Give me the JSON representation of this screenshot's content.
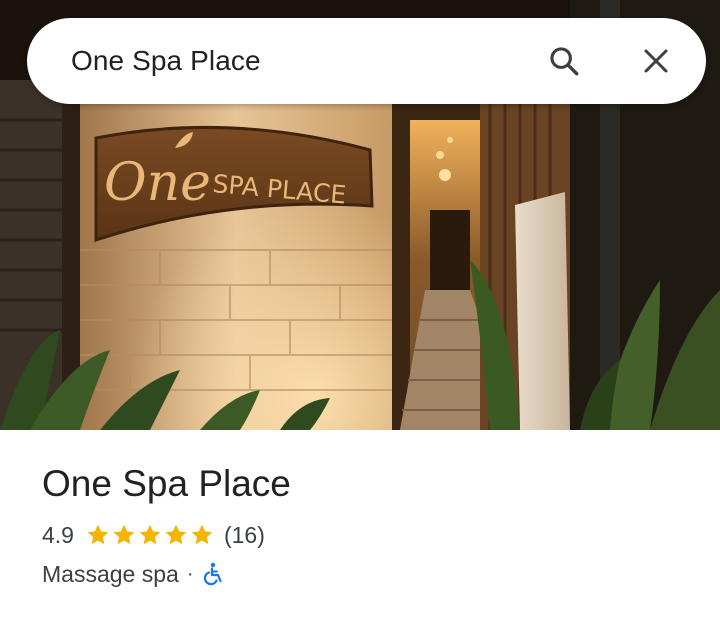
{
  "search": {
    "query": "One Spa Place",
    "search_icon": "search-icon",
    "close_icon": "close-icon"
  },
  "photo": {
    "sign_script": "One",
    "sign_text": "SPA PLACE"
  },
  "place": {
    "name": "One Spa Place",
    "rating": "4.9",
    "stars": 5,
    "review_count": "(16)",
    "category": "Massage spa",
    "separator": "·",
    "accessibility_icon": "wheelchair-accessible-icon"
  },
  "colors": {
    "star": "#f4b400",
    "accessible": "#1a73e8",
    "text_primary": "#202124",
    "text_secondary": "#3c4043"
  }
}
